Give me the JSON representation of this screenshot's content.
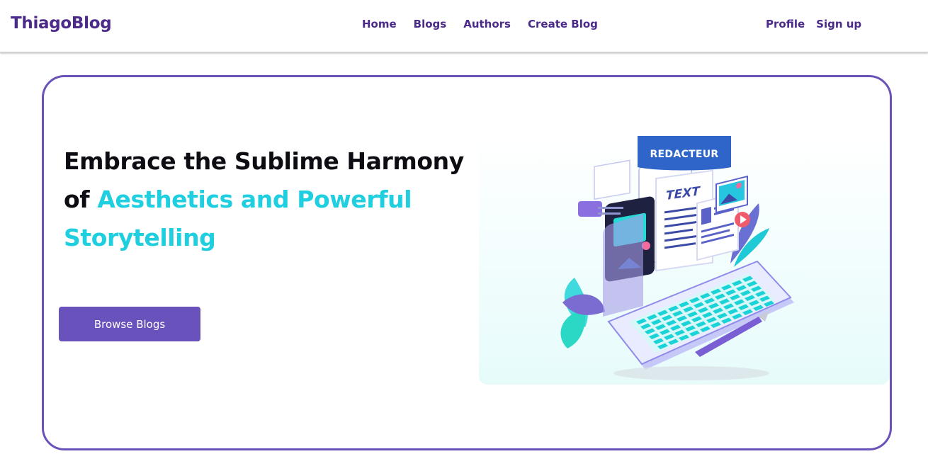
{
  "navbar": {
    "brand": "ThiagoBlog",
    "links": [
      "Home",
      "Blogs",
      "Authors",
      "Create Blog"
    ],
    "right_links": [
      "Profile",
      "Sign up"
    ]
  },
  "hero": {
    "headline_part1": "Embrace the Sublime Harmony of ",
    "headline_accent": "Aesthetics and Powerful Storytelling",
    "button_label": "Browse Blogs",
    "illustration": {
      "badge": "REDACTEUR",
      "doc_label": "TEXT"
    }
  },
  "colors": {
    "brand": "#4b2a8a",
    "accent": "#1fcfe0",
    "button": "#6a52bd",
    "card_border": "#6a52b8"
  }
}
